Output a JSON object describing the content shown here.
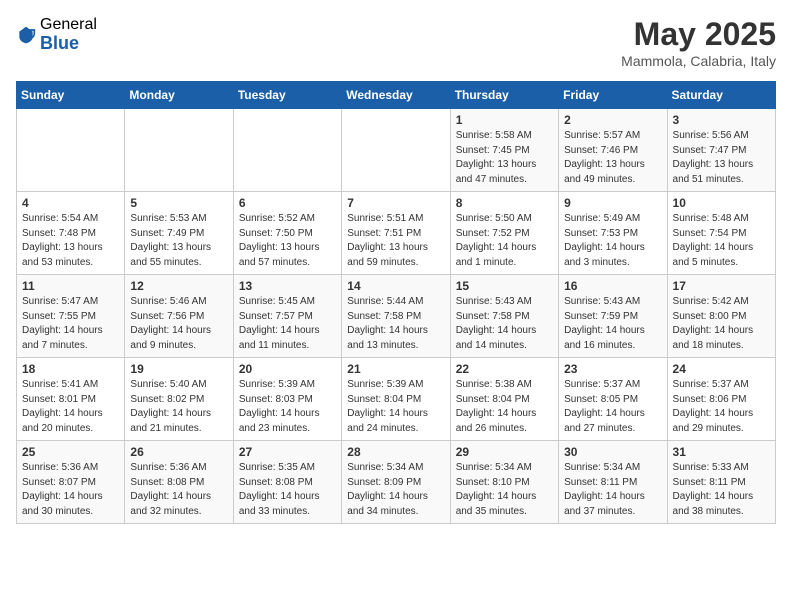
{
  "logo": {
    "general": "General",
    "blue": "Blue"
  },
  "title": "May 2025",
  "subtitle": "Mammola, Calabria, Italy",
  "headers": [
    "Sunday",
    "Monday",
    "Tuesday",
    "Wednesday",
    "Thursday",
    "Friday",
    "Saturday"
  ],
  "weeks": [
    [
      {
        "day": "",
        "info": ""
      },
      {
        "day": "",
        "info": ""
      },
      {
        "day": "",
        "info": ""
      },
      {
        "day": "",
        "info": ""
      },
      {
        "day": "1",
        "info": "Sunrise: 5:58 AM\nSunset: 7:45 PM\nDaylight: 13 hours\nand 47 minutes."
      },
      {
        "day": "2",
        "info": "Sunrise: 5:57 AM\nSunset: 7:46 PM\nDaylight: 13 hours\nand 49 minutes."
      },
      {
        "day": "3",
        "info": "Sunrise: 5:56 AM\nSunset: 7:47 PM\nDaylight: 13 hours\nand 51 minutes."
      }
    ],
    [
      {
        "day": "4",
        "info": "Sunrise: 5:54 AM\nSunset: 7:48 PM\nDaylight: 13 hours\nand 53 minutes."
      },
      {
        "day": "5",
        "info": "Sunrise: 5:53 AM\nSunset: 7:49 PM\nDaylight: 13 hours\nand 55 minutes."
      },
      {
        "day": "6",
        "info": "Sunrise: 5:52 AM\nSunset: 7:50 PM\nDaylight: 13 hours\nand 57 minutes."
      },
      {
        "day": "7",
        "info": "Sunrise: 5:51 AM\nSunset: 7:51 PM\nDaylight: 13 hours\nand 59 minutes."
      },
      {
        "day": "8",
        "info": "Sunrise: 5:50 AM\nSunset: 7:52 PM\nDaylight: 14 hours\nand 1 minute."
      },
      {
        "day": "9",
        "info": "Sunrise: 5:49 AM\nSunset: 7:53 PM\nDaylight: 14 hours\nand 3 minutes."
      },
      {
        "day": "10",
        "info": "Sunrise: 5:48 AM\nSunset: 7:54 PM\nDaylight: 14 hours\nand 5 minutes."
      }
    ],
    [
      {
        "day": "11",
        "info": "Sunrise: 5:47 AM\nSunset: 7:55 PM\nDaylight: 14 hours\nand 7 minutes."
      },
      {
        "day": "12",
        "info": "Sunrise: 5:46 AM\nSunset: 7:56 PM\nDaylight: 14 hours\nand 9 minutes."
      },
      {
        "day": "13",
        "info": "Sunrise: 5:45 AM\nSunset: 7:57 PM\nDaylight: 14 hours\nand 11 minutes."
      },
      {
        "day": "14",
        "info": "Sunrise: 5:44 AM\nSunset: 7:58 PM\nDaylight: 14 hours\nand 13 minutes."
      },
      {
        "day": "15",
        "info": "Sunrise: 5:43 AM\nSunset: 7:58 PM\nDaylight: 14 hours\nand 14 minutes."
      },
      {
        "day": "16",
        "info": "Sunrise: 5:43 AM\nSunset: 7:59 PM\nDaylight: 14 hours\nand 16 minutes."
      },
      {
        "day": "17",
        "info": "Sunrise: 5:42 AM\nSunset: 8:00 PM\nDaylight: 14 hours\nand 18 minutes."
      }
    ],
    [
      {
        "day": "18",
        "info": "Sunrise: 5:41 AM\nSunset: 8:01 PM\nDaylight: 14 hours\nand 20 minutes."
      },
      {
        "day": "19",
        "info": "Sunrise: 5:40 AM\nSunset: 8:02 PM\nDaylight: 14 hours\nand 21 minutes."
      },
      {
        "day": "20",
        "info": "Sunrise: 5:39 AM\nSunset: 8:03 PM\nDaylight: 14 hours\nand 23 minutes."
      },
      {
        "day": "21",
        "info": "Sunrise: 5:39 AM\nSunset: 8:04 PM\nDaylight: 14 hours\nand 24 minutes."
      },
      {
        "day": "22",
        "info": "Sunrise: 5:38 AM\nSunset: 8:04 PM\nDaylight: 14 hours\nand 26 minutes."
      },
      {
        "day": "23",
        "info": "Sunrise: 5:37 AM\nSunset: 8:05 PM\nDaylight: 14 hours\nand 27 minutes."
      },
      {
        "day": "24",
        "info": "Sunrise: 5:37 AM\nSunset: 8:06 PM\nDaylight: 14 hours\nand 29 minutes."
      }
    ],
    [
      {
        "day": "25",
        "info": "Sunrise: 5:36 AM\nSunset: 8:07 PM\nDaylight: 14 hours\nand 30 minutes."
      },
      {
        "day": "26",
        "info": "Sunrise: 5:36 AM\nSunset: 8:08 PM\nDaylight: 14 hours\nand 32 minutes."
      },
      {
        "day": "27",
        "info": "Sunrise: 5:35 AM\nSunset: 8:08 PM\nDaylight: 14 hours\nand 33 minutes."
      },
      {
        "day": "28",
        "info": "Sunrise: 5:34 AM\nSunset: 8:09 PM\nDaylight: 14 hours\nand 34 minutes."
      },
      {
        "day": "29",
        "info": "Sunrise: 5:34 AM\nSunset: 8:10 PM\nDaylight: 14 hours\nand 35 minutes."
      },
      {
        "day": "30",
        "info": "Sunrise: 5:34 AM\nSunset: 8:11 PM\nDaylight: 14 hours\nand 37 minutes."
      },
      {
        "day": "31",
        "info": "Sunrise: 5:33 AM\nSunset: 8:11 PM\nDaylight: 14 hours\nand 38 minutes."
      }
    ]
  ]
}
